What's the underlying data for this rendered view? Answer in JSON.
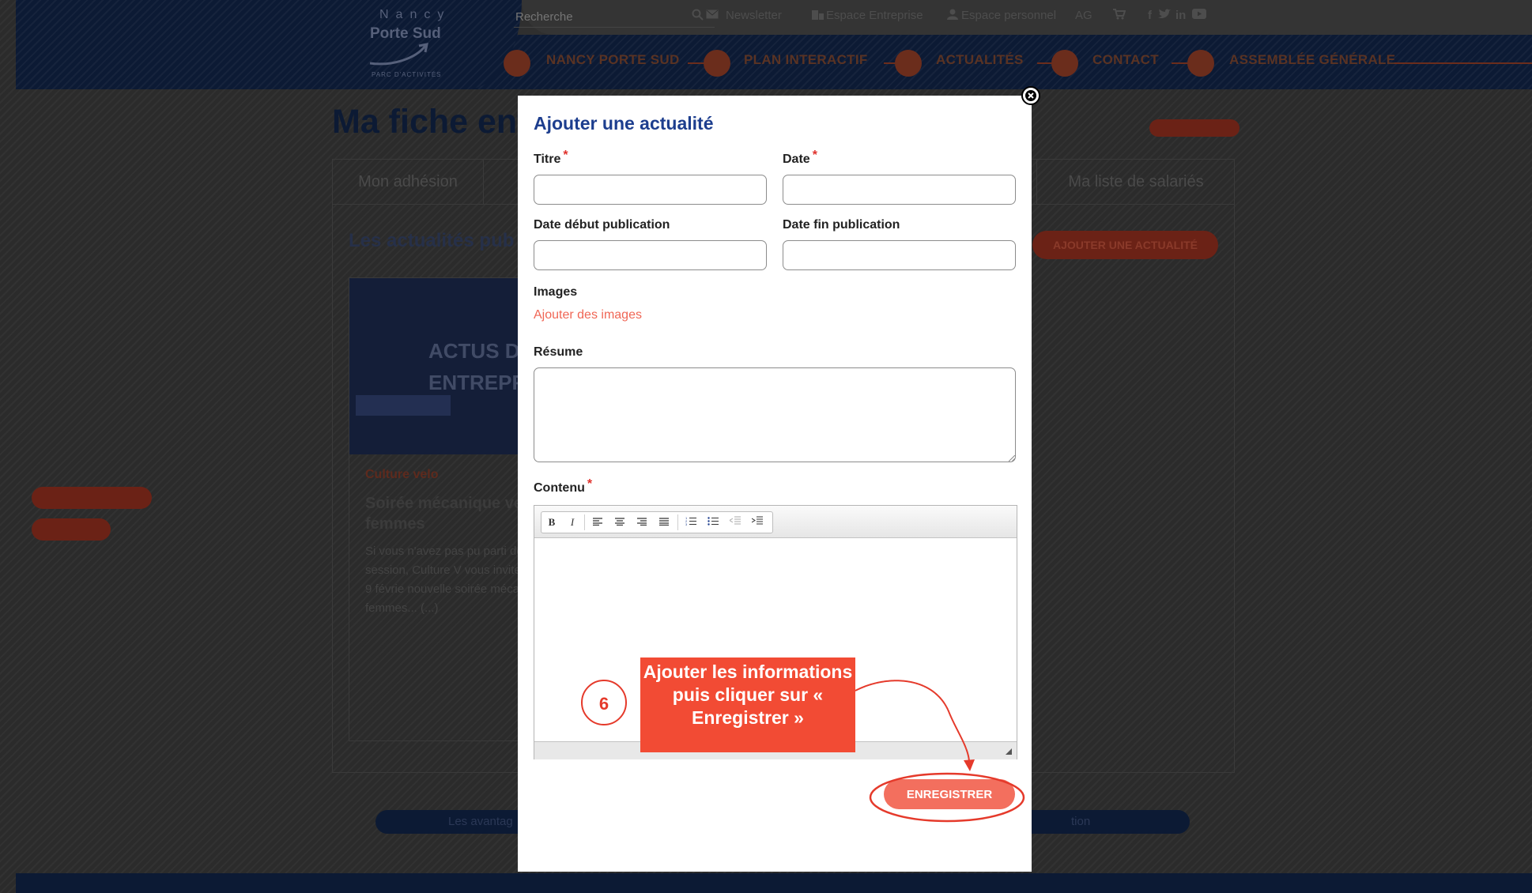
{
  "header": {
    "logo": {
      "line1": "Nancy",
      "line2": "Porte Sud",
      "line3": "PARC D'ACTIVITÉS"
    },
    "search_placeholder": "Recherche",
    "top_links": [
      "Newsletter",
      "Espace Entreprise",
      "Espace personnel"
    ],
    "lang": "AG",
    "social_icons": [
      "facebook-icon",
      "twitter-icon",
      "linkedin-icon",
      "youtube-icon"
    ],
    "nav": [
      "NANCY PORTE SUD",
      "PLAN INTERACTIF",
      "ACTUALITÉS",
      "CONTACT",
      "ASSEMBLÉE GÉNÉRALE"
    ]
  },
  "page": {
    "title": "Ma fiche ent",
    "tabs": [
      "Mon adhésion",
      "Ma liste de salariés"
    ],
    "section_title": "Les actualités pub",
    "add_button": "AJOUTER UNE ACTUALITÉ",
    "card": {
      "image_text": [
        "ACTUS D",
        "ENTREPRI"
      ],
      "category": "Culture velo",
      "title": "Soirée mécanique ve femmes",
      "excerpt": "Si vous n'avez pas pu parti dernière session, Culture V vous invite le jeudi 9 févrie nouvelle soirée mécaniqu femmes... (...)"
    },
    "bottom_bar": [
      "Les avantag",
      "tion"
    ]
  },
  "modal": {
    "title": "Ajouter une actualité",
    "fields": {
      "titre": {
        "label": "Titre",
        "value": ""
      },
      "date": {
        "label": "Date",
        "value": ""
      },
      "date_debut": {
        "label": "Date début publication",
        "value": ""
      },
      "date_fin": {
        "label": "Date fin publication",
        "value": ""
      },
      "images": {
        "label": "Images",
        "link": "Ajouter des images"
      },
      "resume": {
        "label": "Résume"
      },
      "contenu": {
        "label": "Contenu"
      }
    },
    "required_mark": "*",
    "save_label": "ENREGISTRER"
  },
  "annotation": {
    "step_number": "6",
    "text": "Ajouter les informations puis cliquer sur « Enregistrer »"
  },
  "colors": {
    "title_blue": "#1d3e8e",
    "accent": "#f36f5e",
    "annotation": "#f24b34",
    "required": "#e0312b"
  }
}
